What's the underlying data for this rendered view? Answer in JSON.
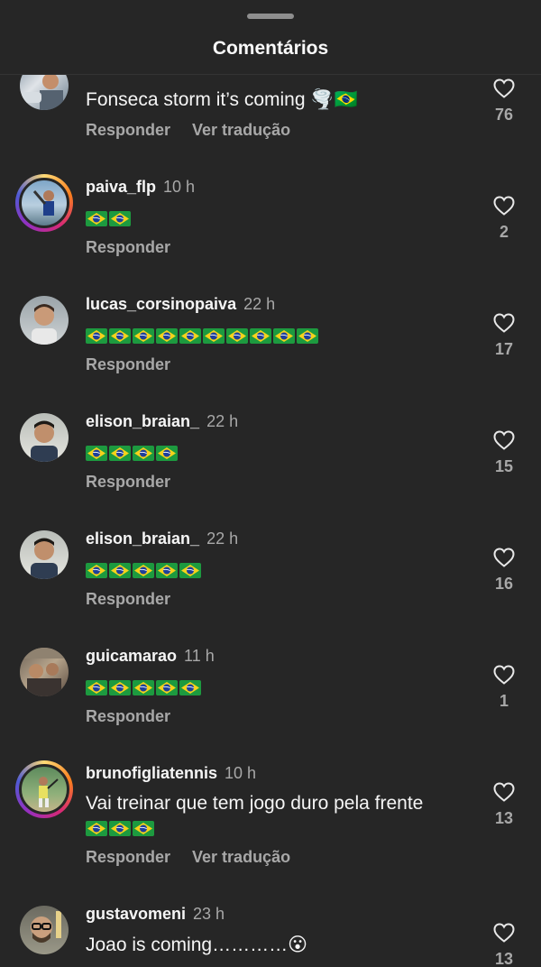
{
  "header": {
    "title": "Comentários"
  },
  "actions": {
    "reply": "Responder",
    "translate": "Ver tradução"
  },
  "comments": [
    {
      "username": "",
      "time": "",
      "text": "Fonseca storm it’s coming 🌪️🇧🇷",
      "likes": "76",
      "show_translate": true
    },
    {
      "username": "paiva_flp",
      "time": "10 h",
      "text": "🇧🇷🇧🇷",
      "flag_count": 2,
      "likes": "2"
    },
    {
      "username": "lucas_corsinopaiva",
      "time": "22 h",
      "text": "🇧🇷🇧🇷🇧🇷🇧🇷🇧🇷🇧🇷🇧🇷🇧🇷🇧🇷🇧🇷",
      "flag_count": 10,
      "likes": "17"
    },
    {
      "username": "elison_braian_",
      "time": "22 h",
      "text": "🇧🇷🇧🇷🇧🇷🇧🇷",
      "flag_count": 4,
      "likes": "15"
    },
    {
      "username": "elison_braian_",
      "time": "22 h",
      "text": "🇧🇷🇧🇷🇧🇷🇧🇷🇧🇷",
      "flag_count": 5,
      "likes": "16"
    },
    {
      "username": "guicamarao",
      "time": "11 h",
      "text": "🇧🇷🇧🇷🇧🇷🇧🇷🇧🇷",
      "flag_count": 5,
      "likes": "1"
    },
    {
      "username": "brunofigliatennis",
      "time": "10 h",
      "text": "Vai treinar que tem jogo duro pela frente",
      "text2": "🇧🇷🇧🇷🇧🇷",
      "flag_count2": 3,
      "likes": "13",
      "show_translate": true
    },
    {
      "username": "gustavomeni",
      "time": "23 h",
      "text": "Joao is coming…………😮",
      "likes": "13"
    }
  ],
  "icons": {
    "like": "heart-outline-icon",
    "flag": "brazil-flag-icon",
    "tornado": "tornado-icon",
    "surprised": "surprised-face-icon"
  },
  "colors": {
    "background": "#262626",
    "primary_text": "#f5f5f5",
    "secondary_text": "#a8a8a8",
    "flag_green": "#1d9a3f",
    "flag_yellow": "#f6d21b",
    "flag_blue": "#1e3f9a"
  }
}
